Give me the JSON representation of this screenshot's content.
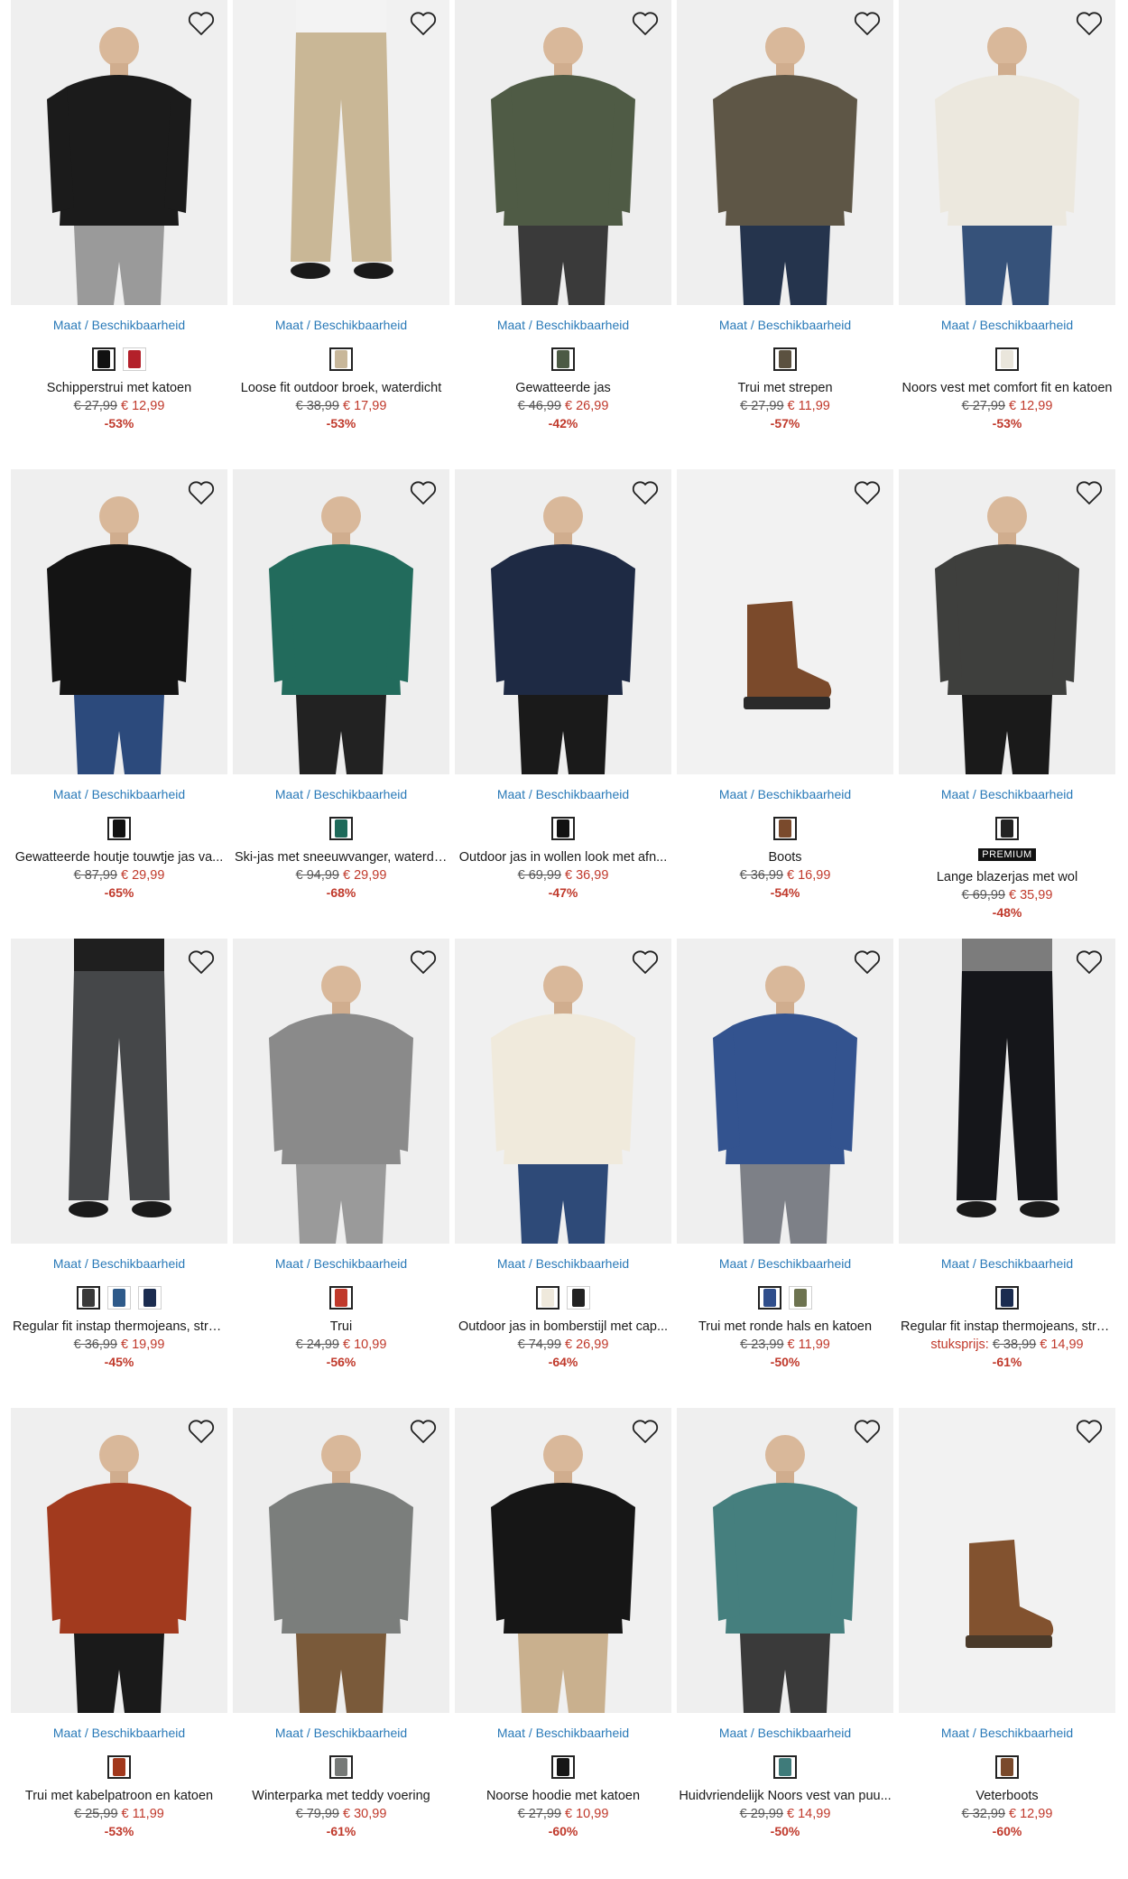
{
  "availability_label": "Maat / Beschikbaarheid",
  "products": [
    {
      "title": "Schipperstrui met katoen",
      "old": "€ 27,99",
      "new": "€ 12,99",
      "discount": "-53%",
      "swatches": [
        "#111111",
        "#b3202a"
      ],
      "bg": "#efefef",
      "top": "#1b1b1b",
      "bottom": "#9a9a9a",
      "kind": "person",
      "icon": "pullover"
    },
    {
      "title": "Loose fit outdoor broek, waterdicht",
      "old": "€ 38,99",
      "new": "€ 17,99",
      "discount": "-53%",
      "swatches": [
        "#c8b79a"
      ],
      "bg": "#f1f1f1",
      "top": "#f3f3f3",
      "bottom": "#c9b796",
      "kind": "pants",
      "icon": "pants"
    },
    {
      "title": "Gewatteerde jas",
      "old": "€ 46,99",
      "new": "€ 26,99",
      "discount": "-42%",
      "swatches": [
        "#4c5a44"
      ],
      "bg": "#eeeeee",
      "top": "#4f5b45",
      "bottom": "#3a3a3a",
      "kind": "person",
      "icon": "jacket"
    },
    {
      "title": "Trui met strepen",
      "old": "€ 27,99",
      "new": "€ 11,99",
      "discount": "-57%",
      "swatches": [
        "#5b5140"
      ],
      "bg": "#efefef",
      "top": "#5e5646",
      "bottom": "#25344d",
      "kind": "person",
      "icon": "pullover"
    },
    {
      "title": "Noors vest met comfort fit en katoen",
      "old": "€ 27,99",
      "new": "€ 12,99",
      "discount": "-53%",
      "swatches": [
        "#eae6dc"
      ],
      "bg": "#f0f0f0",
      "top": "#ece8de",
      "bottom": "#36527a",
      "kind": "person",
      "icon": "cardigan"
    },
    {
      "title": "Gewatteerde houtje touwtje jas va...",
      "old": "€ 87,99",
      "new": "€ 29,99",
      "discount": "-65%",
      "swatches": [
        "#111111"
      ],
      "bg": "#efefef",
      "top": "#141414",
      "bottom": "#2c4a7c",
      "kind": "person",
      "icon": "coat"
    },
    {
      "title": "Ski-jas met sneeuwvanger, waterdi...",
      "old": "€ 94,99",
      "new": "€ 29,99",
      "discount": "-68%",
      "swatches": [
        "#1e6a5a"
      ],
      "bg": "#eeeeee",
      "top": "#226b5c",
      "bottom": "#222222",
      "kind": "person",
      "icon": "jacket"
    },
    {
      "title": "Outdoor jas in wollen look met afn...",
      "old": "€ 69,99",
      "new": "€ 36,99",
      "discount": "-47%",
      "swatches": [
        "#111111"
      ],
      "bg": "#efefef",
      "top": "#1e2a44",
      "bottom": "#1a1a1a",
      "kind": "person",
      "icon": "coat"
    },
    {
      "title": "Boots",
      "old": "€ 36,99",
      "new": "€ 16,99",
      "discount": "-54%",
      "swatches": [
        "#7a4a2c"
      ],
      "bg": "#f2f2f2",
      "top": "#7b4a2b",
      "bottom": "#2a2a2a",
      "kind": "boot",
      "icon": "boot"
    },
    {
      "title": "Lange blazerjas met wol",
      "old": "€ 69,99",
      "new": "€ 35,99",
      "discount": "-48%",
      "swatches": [
        "#222222"
      ],
      "bg": "#efefef",
      "top": "#3e3f3d",
      "bottom": "#1a1a1a",
      "kind": "person",
      "icon": "coat",
      "badge": "PREMIUM"
    },
    {
      "title": "Regular fit instap thermojeans, stra...",
      "old": "€ 36,99",
      "new": "€ 19,99",
      "discount": "-45%",
      "swatches": [
        "#3a3a3a",
        "#2e5a8a",
        "#1b2c50"
      ],
      "bg": "#efefef",
      "top": "#1f1f1f",
      "bottom": "#454749",
      "kind": "pants",
      "icon": "pants"
    },
    {
      "title": "Trui",
      "old": "€ 24,99",
      "new": "€ 10,99",
      "discount": "-56%",
      "swatches": [
        "#c0392b"
      ],
      "bg": "#efefef",
      "top": "#8a8a8a",
      "bottom": "#9a9a9a",
      "kind": "person",
      "icon": "pullover"
    },
    {
      "title": "Outdoor jas in bomberstijl met cap...",
      "old": "€ 74,99",
      "new": "€ 26,99",
      "discount": "-64%",
      "swatches": [
        "#efe9dc",
        "#222222"
      ],
      "bg": "#f0f0f0",
      "top": "#f0eadc",
      "bottom": "#2e4a78",
      "kind": "person",
      "icon": "jacket"
    },
    {
      "title": "Trui met ronde hals en katoen",
      "old": "€ 23,99",
      "new": "€ 11,99",
      "discount": "-50%",
      "swatches": [
        "#2f4e8c",
        "#6d7350"
      ],
      "bg": "#efefef",
      "top": "#33538f",
      "bottom": "#7d8087",
      "kind": "person",
      "icon": "pullover"
    },
    {
      "title": "Regular fit instap thermojeans, stra...",
      "old": "€ 38,99",
      "new": "€ 14,99",
      "discount": "-61%",
      "unit": "stuksprijs:",
      "swatches": [
        "#1b2c50"
      ],
      "bg": "#efefef",
      "top": "#7c7c7c",
      "bottom": "#15161a",
      "kind": "pants",
      "icon": "pants"
    },
    {
      "title": "Trui met kabelpatroon en katoen",
      "old": "€ 25,99",
      "new": "€ 11,99",
      "discount": "-53%",
      "swatches": [
        "#a2381c"
      ],
      "bg": "#efefef",
      "top": "#a23a1e",
      "bottom": "#1a1a1a",
      "kind": "person",
      "icon": "pullover"
    },
    {
      "title": "Winterparka met teddy voering",
      "old": "€ 79,99",
      "new": "€ 30,99",
      "discount": "-61%",
      "swatches": [
        "#777a78"
      ],
      "bg": "#eeeeee",
      "top": "#7b7e7c",
      "bottom": "#7a5a3a",
      "kind": "person",
      "icon": "coat"
    },
    {
      "title": "Noorse hoodie met katoen",
      "old": "€ 27,99",
      "new": "€ 10,99",
      "discount": "-60%",
      "swatches": [
        "#161616"
      ],
      "bg": "#f0f0f0",
      "top": "#161616",
      "bottom": "#c9b08e",
      "kind": "person",
      "icon": "pullover"
    },
    {
      "title": "Huidvriendelijk Noors vest van puu...",
      "old": "€ 29,99",
      "new": "€ 14,99",
      "discount": "-50%",
      "swatches": [
        "#3f7b7a"
      ],
      "bg": "#efefef",
      "top": "#457f7e",
      "bottom": "#3a3a3a",
      "kind": "person",
      "icon": "cardigan"
    },
    {
      "title": "Veterboots",
      "old": "€ 32,99",
      "new": "€ 12,99",
      "discount": "-60%",
      "swatches": [
        "#7a4a2c"
      ],
      "bg": "#f2f2f2",
      "top": "#82522f",
      "bottom": "#4a3a2a",
      "kind": "boot",
      "icon": "boot"
    }
  ]
}
